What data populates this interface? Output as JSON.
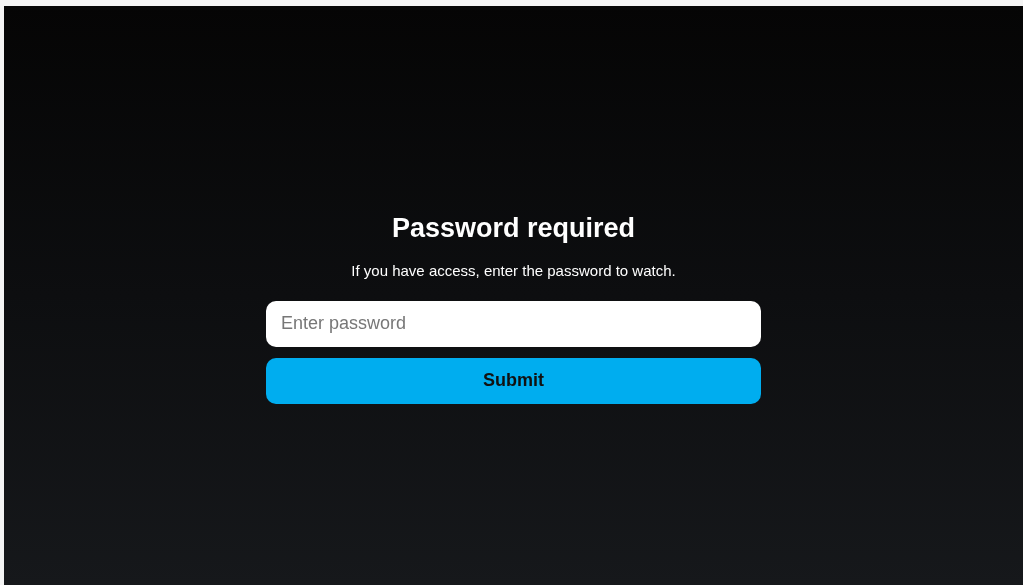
{
  "title": "Password required",
  "message": "If you have access, enter the password to watch.",
  "password_field": {
    "placeholder": "Enter password"
  },
  "submit_button": {
    "label": "Submit"
  }
}
